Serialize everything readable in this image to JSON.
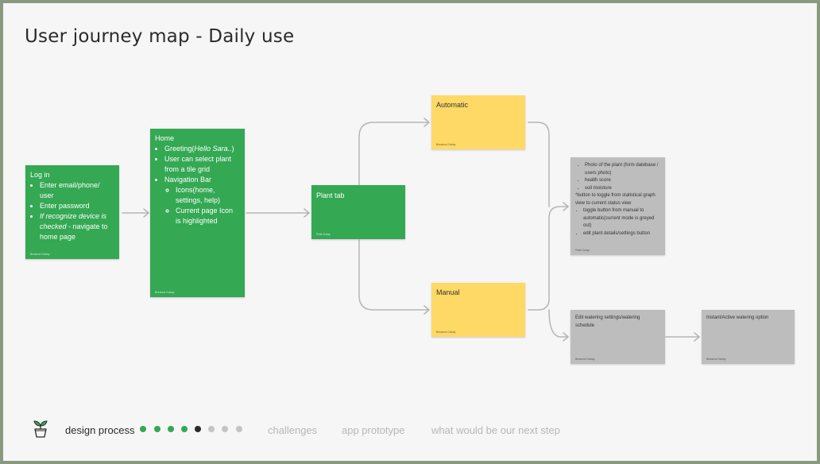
{
  "title": "User journey map - Daily use",
  "cards": {
    "login": {
      "heading": "Log in",
      "items": [
        "Enter email/phone/ user",
        "Enter password"
      ],
      "item3_italic": "If recognize device is checked",
      "item3_rest": " - navigate to home page",
      "author": "Breanna Dubay"
    },
    "home": {
      "heading": "Home",
      "greeting_prefix": "Greeting(",
      "greeting_italic": "Hello Sara..",
      "greeting_suffix": ")",
      "item2": "User can select plant from a tile grid",
      "item3": "Navigation Bar",
      "sub1": "Icons(home, settings, help)",
      "sub2": "Current page Icon is highlighted",
      "author": "Breanna Dubay"
    },
    "plant_tab": {
      "heading": "Plant tab",
      "author": "Pratt Gutay"
    },
    "automatic": {
      "heading": "Automatic",
      "author": "Breanna Dubay"
    },
    "manual": {
      "heading": "Manual",
      "author": "Breanna Dubay"
    },
    "plant_detail": {
      "items": [
        "Photo of the plant (form datebase / users photo)",
        "health score",
        "soil moisture"
      ],
      "note": "*button to toggle from statistical graph view to current status view",
      "items2": [
        "toggle button from manual to automatic(current mode is greyed out)",
        "edit plant details/settings button"
      ],
      "author": "Pratt Gutay"
    },
    "edit_watering": {
      "text": "Edit watering settings/watering schedule",
      "author": "Breanna Dubay"
    },
    "instant_watering": {
      "text": "Instant/Active watering option",
      "author": "Breanna Dubay"
    }
  },
  "footer": {
    "current_section": "design process",
    "links": [
      "challenges",
      "app prototype",
      "what would be our next step"
    ],
    "dots": [
      "active",
      "active",
      "active",
      "active",
      "current",
      "inactive",
      "inactive",
      "inactive"
    ],
    "colors": {
      "active": "#34a853",
      "current": "#2b2b2b",
      "inactive": "#c4c4c4"
    },
    "logo_icon": "plant-pot-icon"
  },
  "colors": {
    "green": "#34a853",
    "yellow": "#ffd966",
    "grey": "#bdbdbd",
    "arrow": "#b5b5b5"
  }
}
